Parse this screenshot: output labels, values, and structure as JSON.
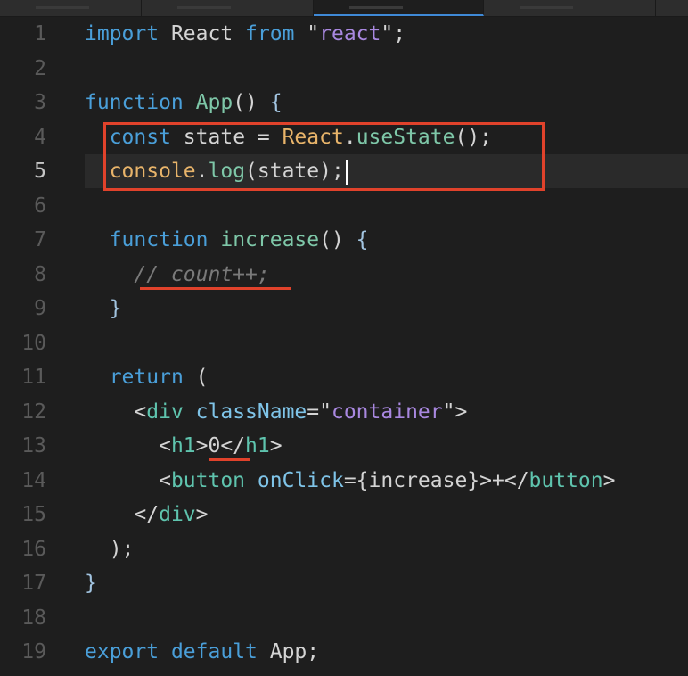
{
  "tabs": [
    "",
    "",
    "",
    "",
    ""
  ],
  "annotation_color": "#e0422b",
  "lines": [
    {
      "number": "1",
      "tokens": [
        {
          "t": "import",
          "c": "keyword-blue"
        },
        {
          "t": " React ",
          "c": "punc"
        },
        {
          "t": "from",
          "c": "keyword-blue"
        },
        {
          "t": " \"",
          "c": "punc"
        },
        {
          "t": "react",
          "c": "str-purple"
        },
        {
          "t": "\";",
          "c": "punc"
        }
      ]
    },
    {
      "number": "2",
      "tokens": []
    },
    {
      "number": "3",
      "tokens": [
        {
          "t": "function",
          "c": "keyword-blue"
        },
        {
          "t": " ",
          "c": "punc"
        },
        {
          "t": "App",
          "c": "fn-green"
        },
        {
          "t": "() ",
          "c": "punc"
        },
        {
          "t": "{",
          "c": "braces"
        }
      ]
    },
    {
      "number": "4",
      "tokens": [
        {
          "t": "  ",
          "c": "punc"
        },
        {
          "t": "const",
          "c": "keyword-blue"
        },
        {
          "t": " state = ",
          "c": "punc"
        },
        {
          "t": "React",
          "c": "obj-orange"
        },
        {
          "t": ".",
          "c": "punc"
        },
        {
          "t": "useState",
          "c": "fn-green"
        },
        {
          "t": "();",
          "c": "punc"
        }
      ]
    },
    {
      "number": "5",
      "tokens": [
        {
          "t": "  ",
          "c": "punc"
        },
        {
          "t": "console",
          "c": "obj-orange"
        },
        {
          "t": ".",
          "c": "punc"
        },
        {
          "t": "log",
          "c": "fn-green"
        },
        {
          "t": "(state);",
          "c": "punc"
        }
      ],
      "current": true
    },
    {
      "number": "6",
      "tokens": []
    },
    {
      "number": "7",
      "tokens": [
        {
          "t": "  ",
          "c": "punc"
        },
        {
          "t": "function",
          "c": "keyword-blue"
        },
        {
          "t": " ",
          "c": "punc"
        },
        {
          "t": "increase",
          "c": "fn-green"
        },
        {
          "t": "() ",
          "c": "punc"
        },
        {
          "t": "{",
          "c": "braces"
        }
      ]
    },
    {
      "number": "8",
      "tokens": [
        {
          "t": "    ",
          "c": "punc"
        },
        {
          "t": "// count++;",
          "c": "gray-italic"
        }
      ]
    },
    {
      "number": "9",
      "tokens": [
        {
          "t": "  ",
          "c": "punc"
        },
        {
          "t": "}",
          "c": "braces"
        }
      ]
    },
    {
      "number": "10",
      "tokens": []
    },
    {
      "number": "11",
      "tokens": [
        {
          "t": "  ",
          "c": "punc"
        },
        {
          "t": "return",
          "c": "keyword-blue"
        },
        {
          "t": " (",
          "c": "punc"
        }
      ]
    },
    {
      "number": "12",
      "tokens": [
        {
          "t": "    <",
          "c": "punc"
        },
        {
          "t": "div",
          "c": "tag-green"
        },
        {
          "t": " ",
          "c": "punc"
        },
        {
          "t": "className",
          "c": "ident-cyan"
        },
        {
          "t": "=\"",
          "c": "punc"
        },
        {
          "t": "container",
          "c": "str-purple"
        },
        {
          "t": "\">",
          "c": "punc"
        }
      ]
    },
    {
      "number": "13",
      "tokens": [
        {
          "t": "      <",
          "c": "punc"
        },
        {
          "t": "h1",
          "c": "tag-green"
        },
        {
          "t": ">0</",
          "c": "punc"
        },
        {
          "t": "h1",
          "c": "tag-green"
        },
        {
          "t": ">",
          "c": "punc"
        }
      ]
    },
    {
      "number": "14",
      "tokens": [
        {
          "t": "      <",
          "c": "punc"
        },
        {
          "t": "button",
          "c": "tag-green"
        },
        {
          "t": " ",
          "c": "punc"
        },
        {
          "t": "onClick",
          "c": "ident-cyan"
        },
        {
          "t": "={increase}>+</",
          "c": "punc"
        },
        {
          "t": "button",
          "c": "tag-green"
        },
        {
          "t": ">",
          "c": "punc"
        }
      ]
    },
    {
      "number": "15",
      "tokens": [
        {
          "t": "    </",
          "c": "punc"
        },
        {
          "t": "div",
          "c": "tag-green"
        },
        {
          "t": ">",
          "c": "punc"
        }
      ]
    },
    {
      "number": "16",
      "tokens": [
        {
          "t": "  );",
          "c": "punc"
        }
      ]
    },
    {
      "number": "17",
      "tokens": [
        {
          "t": "}",
          "c": "braces"
        }
      ]
    },
    {
      "number": "18",
      "tokens": []
    },
    {
      "number": "19",
      "tokens": [
        {
          "t": "export",
          "c": "keyword-blue"
        },
        {
          "t": " ",
          "c": "punc"
        },
        {
          "t": "default",
          "c": "keyword-blue"
        },
        {
          "t": " App;",
          "c": "punc"
        }
      ]
    }
  ]
}
